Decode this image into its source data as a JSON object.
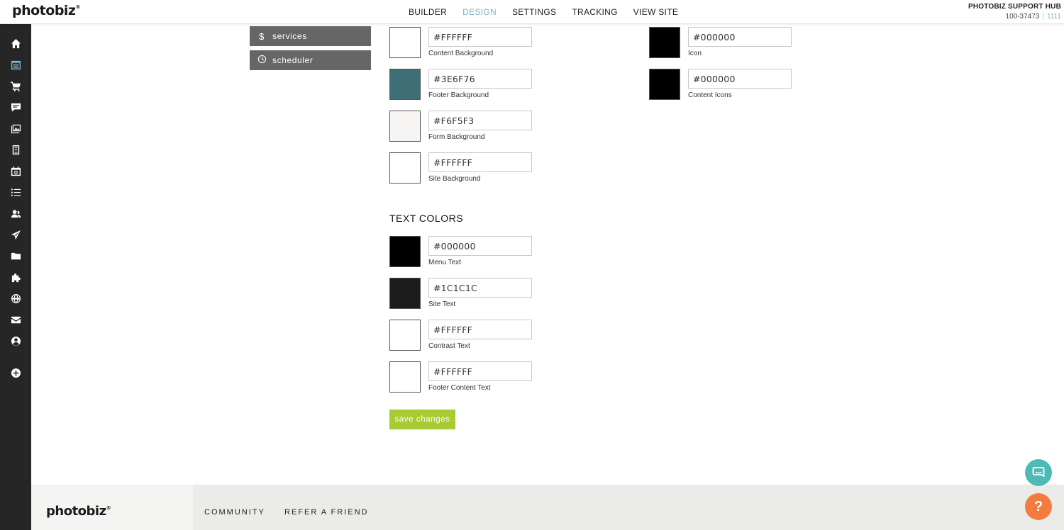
{
  "brand": {
    "logo_text": "photobiz"
  },
  "topnav": {
    "items": [
      {
        "label": "BUILDER"
      },
      {
        "label": "DESIGN"
      },
      {
        "label": "SETTINGS"
      },
      {
        "label": "TRACKING"
      },
      {
        "label": "VIEW SITE"
      }
    ],
    "active_item": "DESIGN"
  },
  "hub": {
    "title": "PHOTOBIZ SUPPORT HUB",
    "account_id": "100-37473",
    "separator": "|",
    "pin": "1111"
  },
  "sidebar": {
    "icons": [
      "home-icon",
      "calendar-list-icon",
      "cart-icon",
      "chat-icon",
      "gallery-icon",
      "book-icon",
      "camera-calendar-icon",
      "list-icon",
      "users-icon",
      "send-icon",
      "folder-icon",
      "puzzle-icon",
      "globe-icon",
      "mail-icon",
      "account-icon",
      "add-icon"
    ],
    "active_icon": "calendar-list-icon"
  },
  "mini_menu": {
    "items": [
      {
        "label": "services",
        "icon": "$"
      },
      {
        "label": "scheduler",
        "icon": "clock-icon"
      }
    ]
  },
  "background_colors": [
    {
      "hex": "#FFFFFF",
      "label": "Content Background",
      "color": "#FFFFFF"
    },
    {
      "hex": "#3E6F76",
      "label": "Footer Background",
      "color": "#3E6F76"
    },
    {
      "hex": "#F6F5F3",
      "label": "Form Background",
      "color": "#F6F5F3"
    },
    {
      "hex": "#FFFFFF",
      "label": "Site Background",
      "color": "#FFFFFF"
    }
  ],
  "icon_colors": [
    {
      "hex": "#000000",
      "label": "Icon",
      "color": "#000000"
    },
    {
      "hex": "#000000",
      "label": "Content Icons",
      "color": "#000000"
    }
  ],
  "text_colors_title": "TEXT COLORS",
  "text_colors": [
    {
      "hex": "#000000",
      "label": "Menu Text",
      "color": "#000000"
    },
    {
      "hex": "#1C1C1C",
      "label": "Site Text",
      "color": "#1C1C1C"
    },
    {
      "hex": "#FFFFFF",
      "label": "Contrast Text",
      "color": "#FFFFFF"
    },
    {
      "hex": "#FFFFFF",
      "label": "Footer Content Text",
      "color": "#FFFFFF"
    }
  ],
  "save_label": "save changes",
  "footer": {
    "logo_text": "photobiz",
    "headings": [
      "COMMUNITY",
      "REFER A FRIEND"
    ]
  },
  "accents": {
    "active_nav": "#7fb3c6",
    "save": "#a7cb32",
    "chat": "#4fb9b6",
    "help": "#f47b3f",
    "sidebar": "#262626"
  },
  "floating": {
    "help_glyph": "?"
  }
}
